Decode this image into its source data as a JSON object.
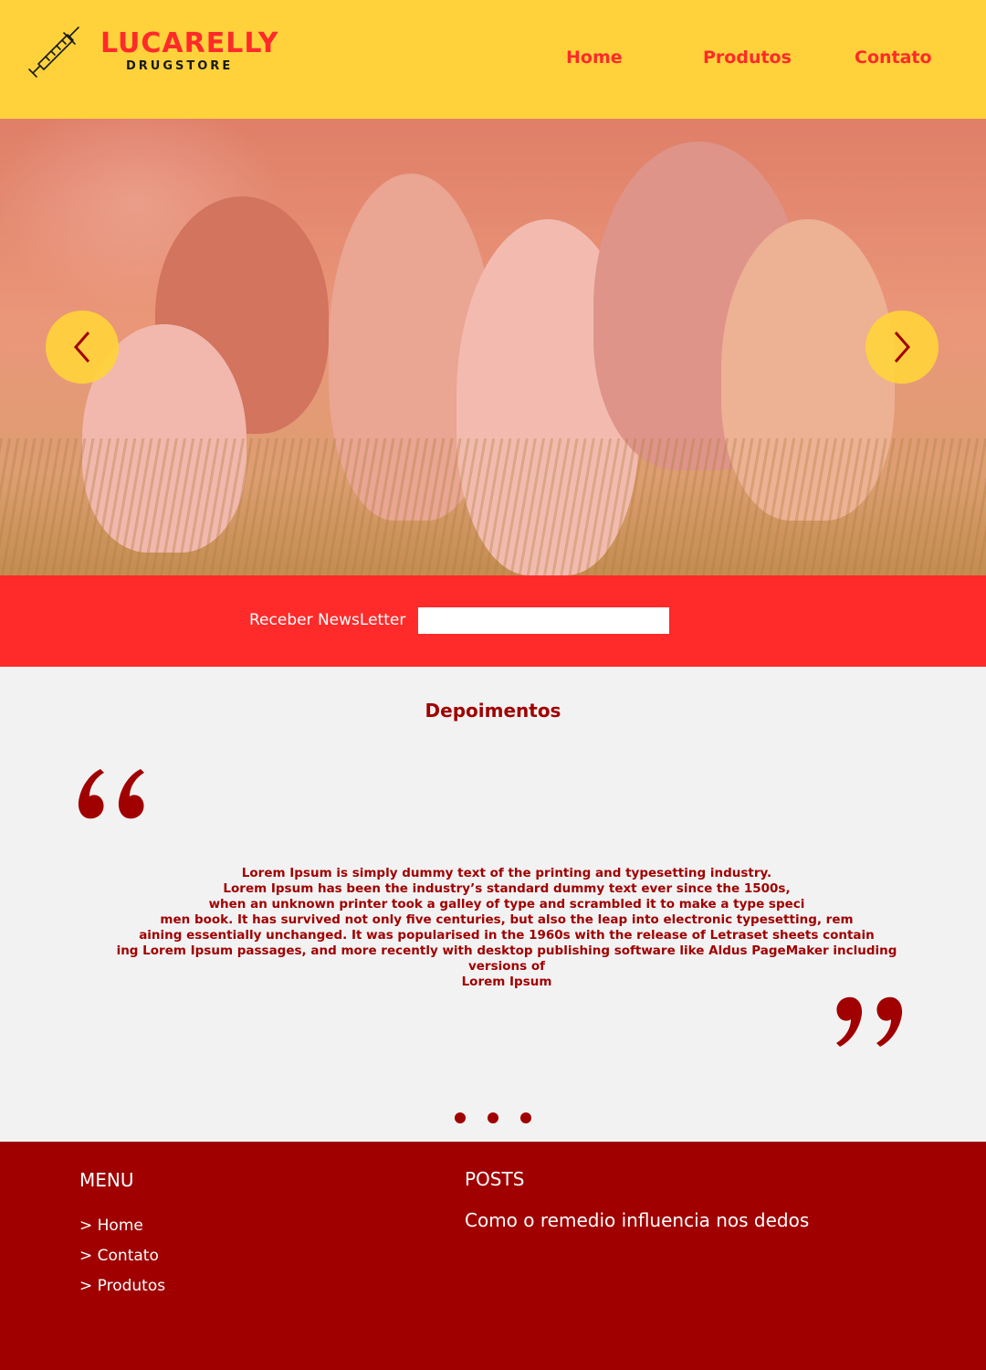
{
  "header": {
    "logo": {
      "title": "LUCARELLY",
      "subtitle": "DRUGSTORE",
      "icon": "syringe-icon"
    },
    "nav": [
      {
        "label": "Home"
      },
      {
        "label": "Produtos"
      },
      {
        "label": "Contato"
      }
    ]
  },
  "hero": {
    "image": "family-photo",
    "prev_icon": "chevron-left-icon",
    "next_icon": "chevron-right-icon"
  },
  "newsletter": {
    "label": "Receber NewsLetter",
    "input_value": ""
  },
  "testimonials": {
    "title": "Depoimentos",
    "text": "Lorem Ipsum is simply dummy text of the printing and typesetting industry.\nLorem Ipsum has been the industry’s standard dummy text ever since the 1500s,\nwhen an unknown printer took a galley of type and scrambled it to make a type speci\nmen book. It has survived not only five centuries, but also the leap into electronic typesetting, rem\naining essentially unchanged. It was popularised in the 1960s with the release of Letraset sheets contain\ning Lorem Ipsum passages, and more recently with desktop publishing software like Aldus PageMaker including versions of\nLorem Ipsum",
    "dots_count": 3
  },
  "footer": {
    "menu_title": "MENU",
    "menu_items": [
      "> Home",
      "> Contato",
      "> Produtos"
    ],
    "posts_title": "POSTS",
    "posts": [
      "Como o remedio influencia nos dedos"
    ]
  },
  "colors": {
    "header_bg": "#ffd23c",
    "accent_red": "#ff2a2a",
    "dark_red": "#a00000",
    "light_bg": "#f2f2f2"
  }
}
